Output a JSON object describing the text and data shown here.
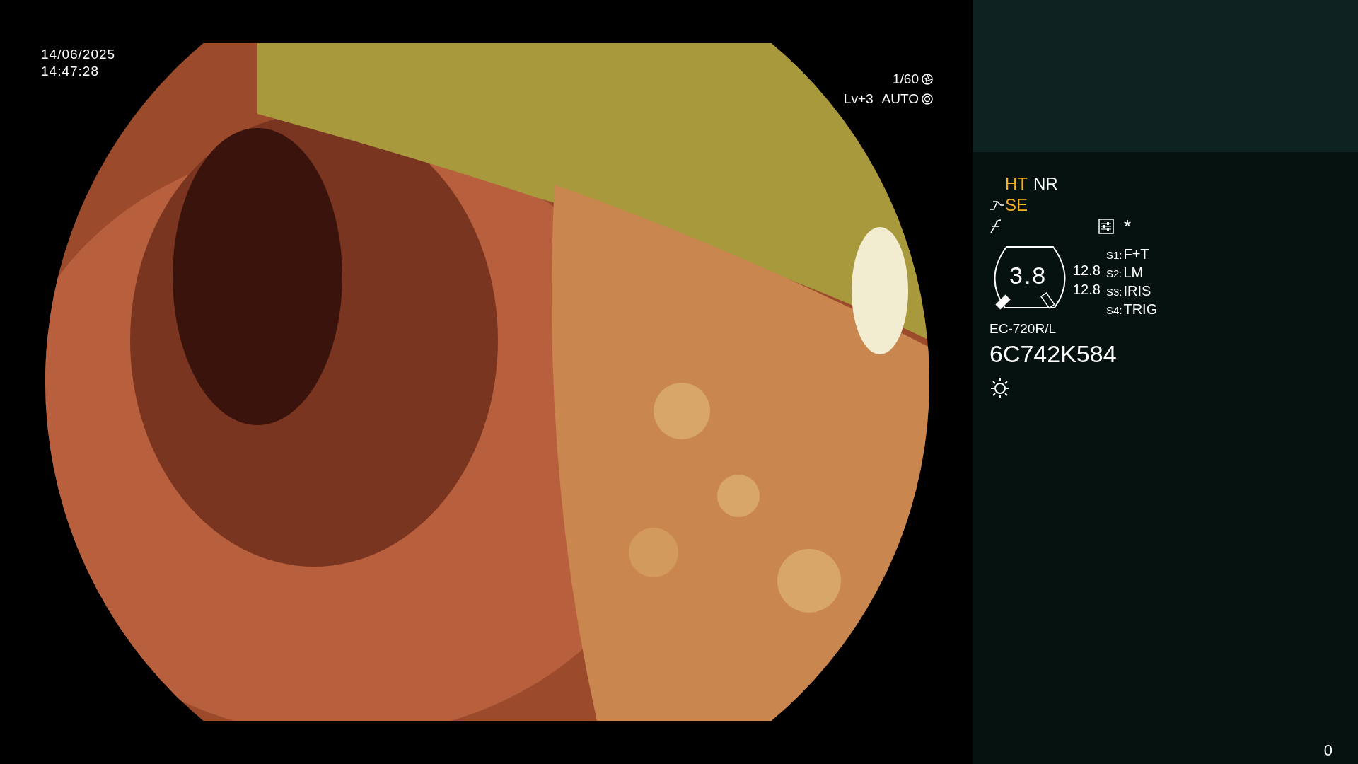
{
  "overlay": {
    "date": "14/06/2025",
    "time": "14:47:28",
    "shutter": "1/60",
    "level": "Lv+3",
    "iris": "AUTO"
  },
  "panel": {
    "modes": [
      {
        "label": "HT",
        "on": true
      },
      {
        "label": "NR",
        "on": false
      }
    ],
    "edge": {
      "label": "SE",
      "on": true
    },
    "gauge": {
      "value": "3.8",
      "readings": [
        "12.8",
        "12.8"
      ]
    },
    "switches": [
      {
        "key": "S1:",
        "value": "F+T"
      },
      {
        "key": "S2:",
        "value": "LM"
      },
      {
        "key": "S3:",
        "value": "IRIS"
      },
      {
        "key": "S4:",
        "value": "TRIG"
      }
    ],
    "scope_model": "EC-720R/L",
    "serial": "6C742K584",
    "asterisk": "*"
  },
  "counter": "0"
}
